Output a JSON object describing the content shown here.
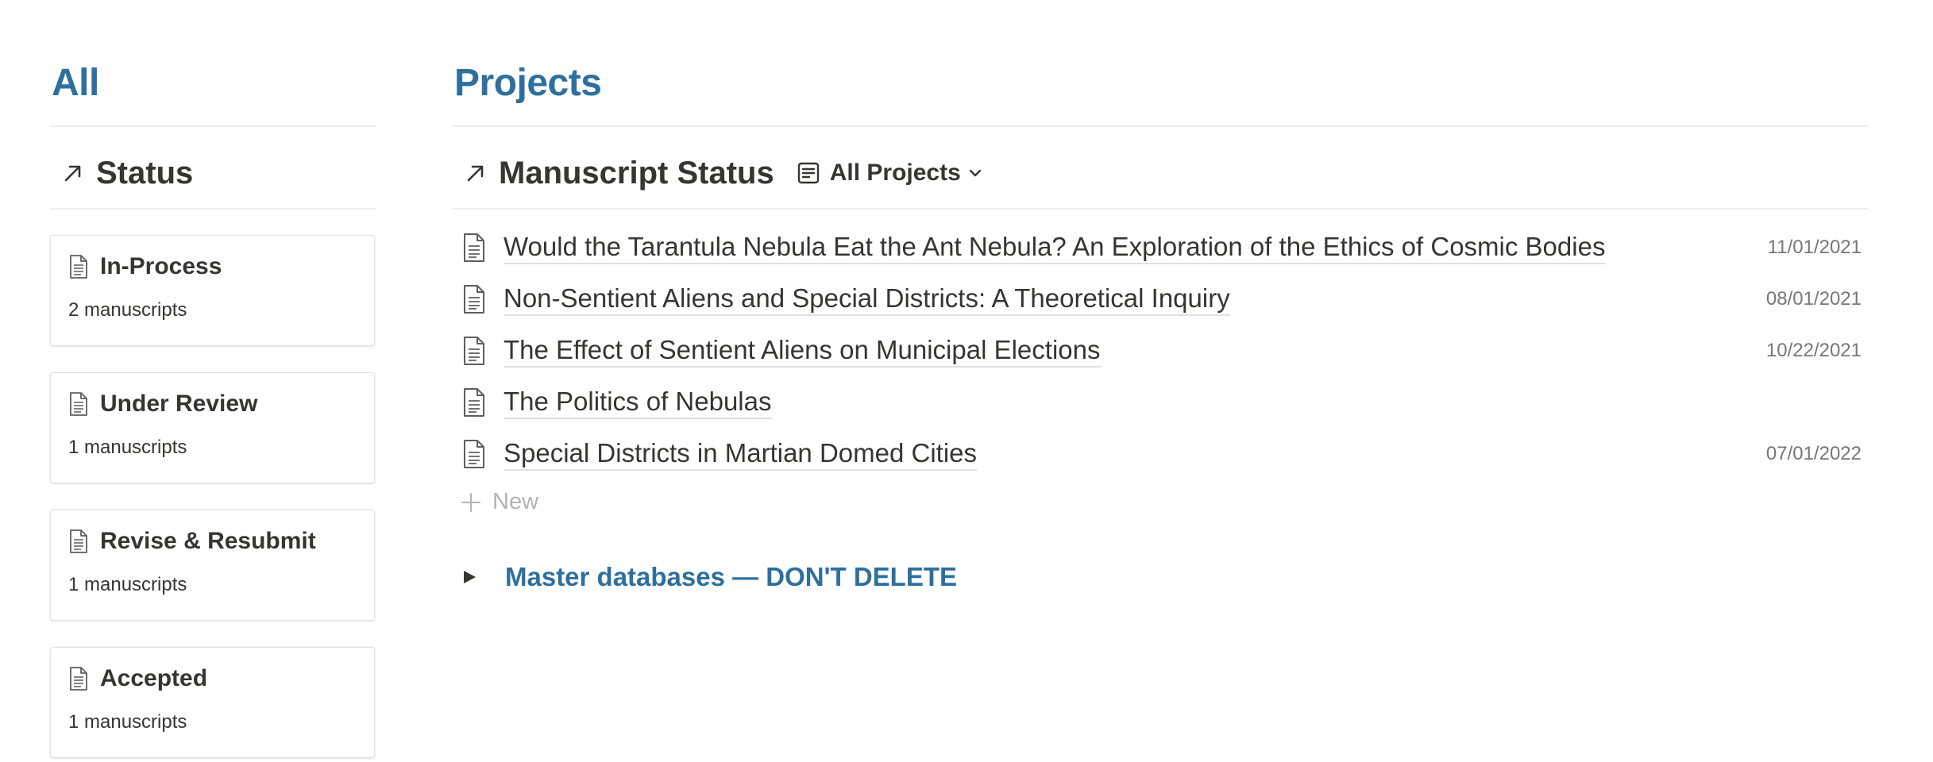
{
  "left": {
    "heading": "All",
    "view_title": "Status",
    "cards": [
      {
        "title": "In-Process",
        "count": "2 manuscripts"
      },
      {
        "title": "Under Review",
        "count": "1 manuscripts"
      },
      {
        "title": "Revise & Resubmit",
        "count": "1 manuscripts"
      },
      {
        "title": "Accepted",
        "count": "1 manuscripts"
      }
    ]
  },
  "right": {
    "heading": "Projects",
    "view_title": "Manuscript Status",
    "view_switcher": "All Projects",
    "rows": [
      {
        "title": "Would the Tarantula Nebula Eat the Ant Nebula? An Exploration of the Ethics of Cosmic Bodies",
        "date": "11/01/2021"
      },
      {
        "title": "Non-Sentient Aliens and Special Districts: A Theoretical Inquiry",
        "date": "08/01/2021"
      },
      {
        "title": "The Effect of Sentient Aliens on Municipal Elections",
        "date": "10/22/2021"
      },
      {
        "title": "The Politics of Nebulas",
        "date": ""
      },
      {
        "title": "Special Districts in Martian Domed Cities",
        "date": "07/01/2022"
      }
    ],
    "new_label": "New",
    "toggle_label": "Master databases — DON'T DELETE"
  },
  "colors": {
    "heading_blue": "#2e6f9e",
    "text": "#37352f",
    "muted": "#787774",
    "divider": "#ededeb"
  },
  "icons": [
    "arrow-up-right-icon",
    "board-view-icon",
    "chevron-down-icon",
    "document-icon",
    "plus-icon",
    "toggle-triangle-icon"
  ]
}
